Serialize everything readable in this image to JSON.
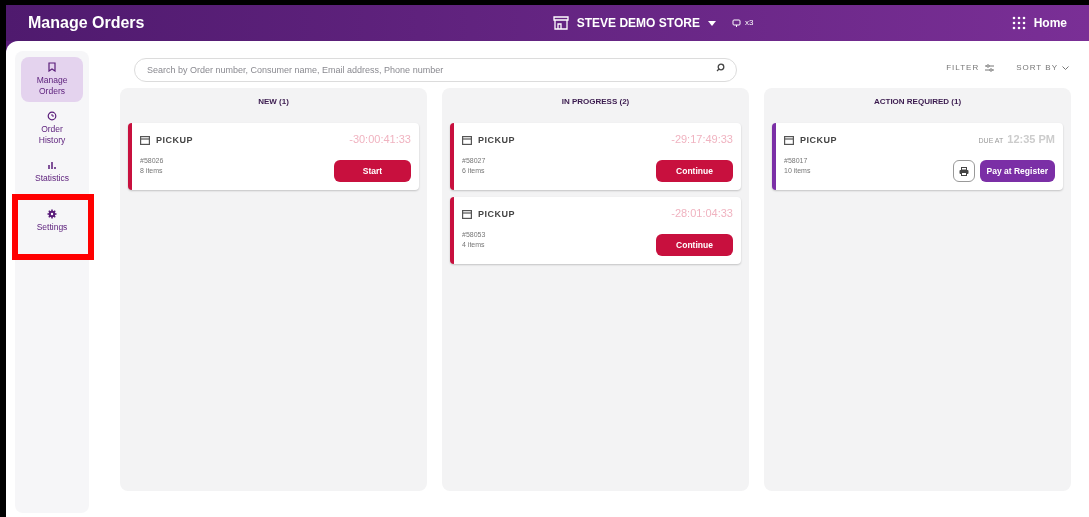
{
  "header": {
    "title": "Manage Orders",
    "store": "STEVE DEMO STORE",
    "device_count": "x3",
    "home": "Home"
  },
  "sidebar": {
    "items": [
      {
        "label": "Manage Orders",
        "kind": "bookmark",
        "selected": true
      },
      {
        "label": "Order History",
        "kind": "history",
        "selected": false
      },
      {
        "label": "Statistics",
        "kind": "chart",
        "selected": false
      },
      {
        "label": "Settings",
        "kind": "gear",
        "selected": false,
        "highlighted": true
      }
    ]
  },
  "search": {
    "placeholder": "Search by Order number, Consumer name, Email address, Phone number"
  },
  "toolbar": {
    "filter": "FILTER",
    "sort": "SORT BY"
  },
  "columns": [
    {
      "title": "NEW (1)",
      "cards": [
        {
          "type": "PICKUP",
          "number": "#58026",
          "items": "8 items",
          "kind": "timer",
          "timer": "-30:00:41:33",
          "action": "Start",
          "color": "#c8103e"
        }
      ]
    },
    {
      "title": "IN PROGRESS (2)",
      "cards": [
        {
          "type": "PICKUP",
          "number": "#58027",
          "items": "6 items",
          "kind": "timer",
          "timer": "-29:17:49:33",
          "action": "Continue",
          "color": "#c8103e"
        },
        {
          "type": "PICKUP",
          "number": "#58053",
          "items": "4 items",
          "kind": "timer",
          "timer": "-28:01:04:33",
          "action": "Continue",
          "color": "#c8103e"
        }
      ]
    },
    {
      "title": "ACTION REQUIRED (1)",
      "cards": [
        {
          "type": "PICKUP",
          "number": "#58017",
          "items": "10 items",
          "kind": "due",
          "due_label": "DUE AT",
          "due_time": "12:35 PM",
          "action": "Pay at Register",
          "color": "#7b2fa6"
        }
      ]
    }
  ]
}
